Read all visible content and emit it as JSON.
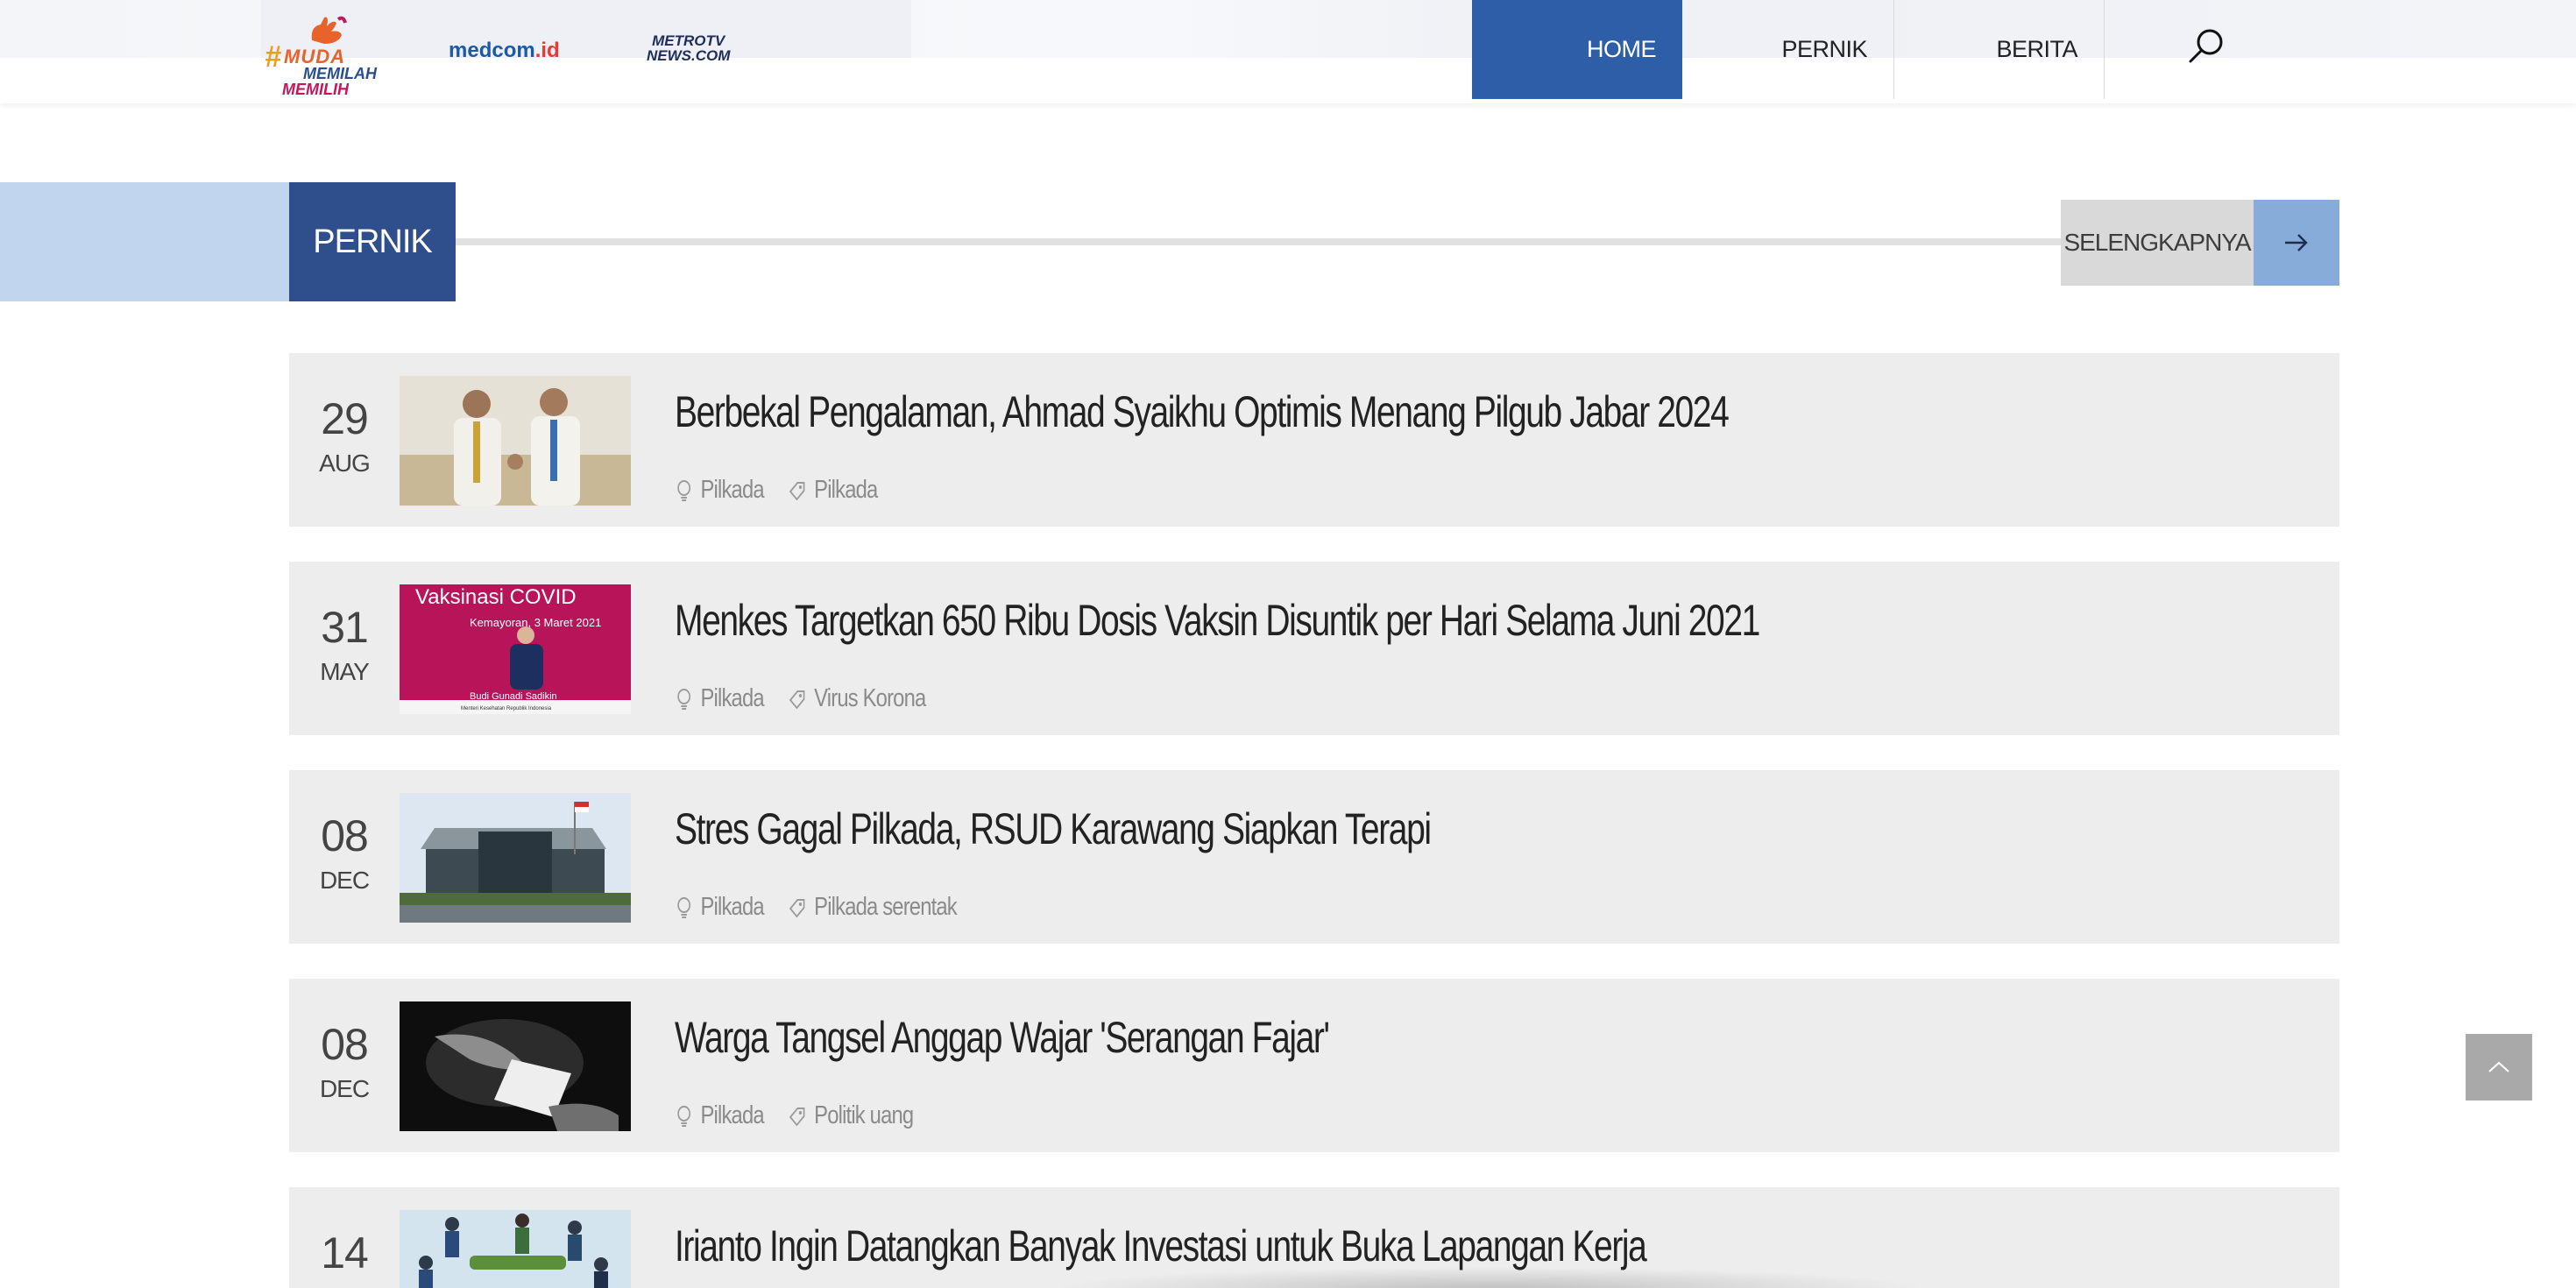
{
  "header": {
    "logos": {
      "muda": [
        "#",
        "MUDA",
        "MEMILAH",
        "MEMILIH"
      ],
      "medcom": {
        "main": "medcom",
        "suffix": ".id"
      },
      "metrotv": [
        "METROTV",
        "NEWS.COM"
      ]
    },
    "nav": [
      {
        "label": "HOME",
        "active": true
      },
      {
        "label": "PERNIK",
        "active": false
      },
      {
        "label": "BERITA",
        "active": false
      }
    ],
    "search_icon": "search-icon"
  },
  "section": {
    "title": "PERNIK",
    "more_label": "SELENGKAPNYA",
    "more_icon": "arrow-right-icon"
  },
  "articles": [
    {
      "day": "29",
      "month": "AUG",
      "title": "Berbekal Pengalaman, Ahmad Syaikhu Optimis Menang Pilgub Jabar 2024",
      "category": "Pilkada",
      "tag": "Pilkada"
    },
    {
      "day": "31",
      "month": "MAY",
      "title": "Menkes Targetkan 650 Ribu Dosis Vaksin Disuntik per Hari Selama Juni 2021",
      "category": "Pilkada",
      "tag": "Virus Korona",
      "thumb_text": {
        "banner": "Vaksinasi COVID",
        "sub": "Kemayoran, 3 Maret 2021",
        "caption": "Budi Gunadi Sadikin",
        "caption2": "Menteri Kesehatan Republik Indonesia"
      }
    },
    {
      "day": "08",
      "month": "DEC",
      "title": "Stres Gagal Pilkada, RSUD Karawang Siapkan Terapi",
      "category": "Pilkada",
      "tag": "Pilkada serentak"
    },
    {
      "day": "08",
      "month": "DEC",
      "title": "Warga Tangsel Anggap Wajar 'Serangan Fajar'",
      "category": "Pilkada",
      "tag": "Politik uang"
    },
    {
      "day": "14",
      "month": "",
      "title": "Irianto Ingin Datangkan Banyak Investasi untuk Buka Lapangan Kerja",
      "category": "",
      "tag": ""
    }
  ],
  "scroll_top_icon": "chevron-up-icon",
  "colors": {
    "nav_active": "#2e5ea8",
    "section_title_bg": "#2e4e8c",
    "section_band": "#c2d5ee",
    "more_arrow_bg": "#87acd9",
    "card_bg": "#ededed"
  }
}
